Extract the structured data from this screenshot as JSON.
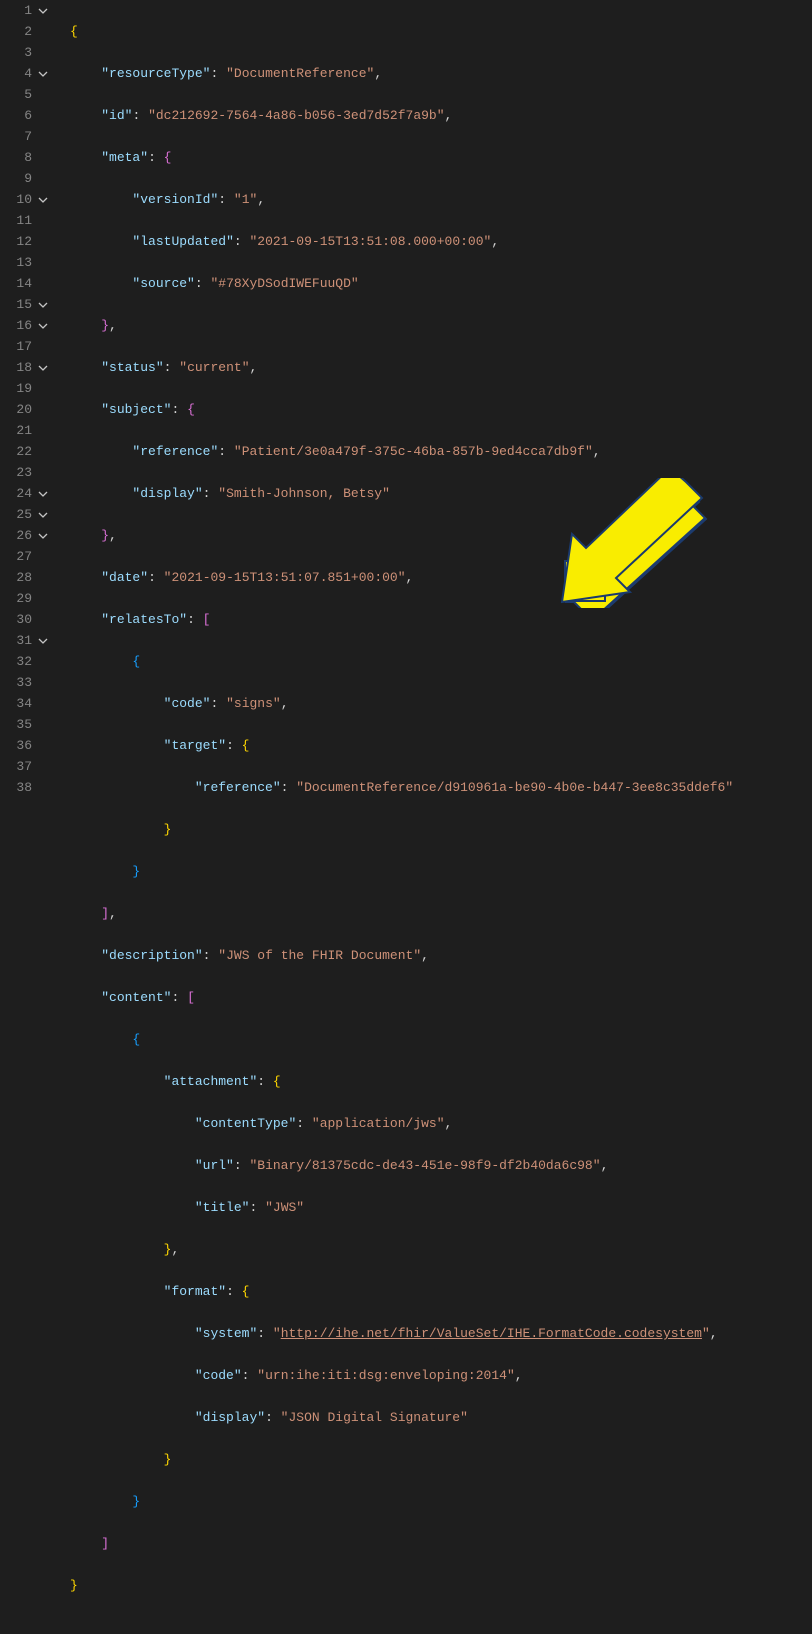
{
  "document": {
    "resourceType": "DocumentReference",
    "id": "dc212692-7564-4a86-b056-3ed7d52f7a9b",
    "meta": {
      "versionId": "1",
      "lastUpdated": "2021-09-15T13:51:08.000+00:00",
      "source": "#78XyDSodIWEFuuQD"
    },
    "status": "current",
    "subject": {
      "reference": "Patient/3e0a479f-375c-46ba-857b-9ed4cca7db9f",
      "display": "Smith-Johnson, Betsy"
    },
    "date": "2021-09-15T13:51:07.851+00:00",
    "relatesTo_code": "signs",
    "relatesTo_target_reference": "DocumentReference/d910961a-be90-4b0e-b447-3ee8c35ddef6",
    "description": "JWS of the FHIR Document",
    "content_attachment_contentType": "application/jws",
    "content_attachment_url": "Binary/81375cdc-de43-451e-98f9-df2b40da6c98",
    "content_attachment_title": "JWS",
    "content_format_system": "http://ihe.net/fhir/ValueSet/IHE.FormatCode.codesystem",
    "content_format_code": "urn:ihe:iti:dsg:enveloping:2014",
    "content_format_display": "JSON Digital Signature"
  },
  "keys": {
    "resourceType": "resourceType",
    "id": "id",
    "meta": "meta",
    "versionId": "versionId",
    "lastUpdated": "lastUpdated",
    "source": "source",
    "status": "status",
    "subject": "subject",
    "reference": "reference",
    "display": "display",
    "date": "date",
    "relatesTo": "relatesTo",
    "code": "code",
    "target": "target",
    "description": "description",
    "content": "content",
    "attachment": "attachment",
    "contentType": "contentType",
    "url": "url",
    "title": "title",
    "format": "format",
    "system": "system"
  },
  "lines": [
    1,
    2,
    3,
    4,
    5,
    6,
    7,
    8,
    9,
    10,
    11,
    12,
    13,
    14,
    15,
    16,
    17,
    18,
    19,
    20,
    21,
    22,
    23,
    24,
    25,
    26,
    27,
    28,
    29,
    30,
    31,
    32,
    33,
    34,
    35,
    36,
    37,
    38
  ],
  "fold_lines": [
    1,
    4,
    10,
    15,
    16,
    18,
    24,
    25,
    26,
    31
  ]
}
